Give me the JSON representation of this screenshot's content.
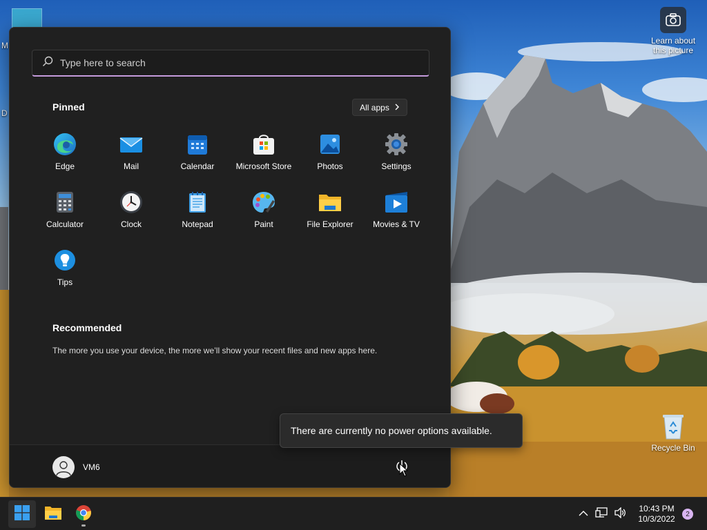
{
  "desktop": {
    "learn_label_line1": "Learn about",
    "learn_label_line2": "this picture",
    "recycle_label": "Recycle Bin",
    "left_label_1": "M",
    "left_label_2": "D"
  },
  "start_menu": {
    "search_placeholder": "Type here to search",
    "pinned_title": "Pinned",
    "all_apps_label": "All apps",
    "pinned_apps": [
      {
        "label": "Edge",
        "icon": "edge-icon"
      },
      {
        "label": "Mail",
        "icon": "mail-icon"
      },
      {
        "label": "Calendar",
        "icon": "calendar-icon"
      },
      {
        "label": "Microsoft Store",
        "icon": "store-icon"
      },
      {
        "label": "Photos",
        "icon": "photos-icon"
      },
      {
        "label": "Settings",
        "icon": "settings-icon"
      },
      {
        "label": "Calculator",
        "icon": "calculator-icon"
      },
      {
        "label": "Clock",
        "icon": "clock-icon"
      },
      {
        "label": "Notepad",
        "icon": "notepad-icon"
      },
      {
        "label": "Paint",
        "icon": "paint-icon"
      },
      {
        "label": "File Explorer",
        "icon": "file-explorer-icon"
      },
      {
        "label": "Movies & TV",
        "icon": "movies-tv-icon"
      },
      {
        "label": "Tips",
        "icon": "tips-icon"
      }
    ],
    "recommended_title": "Recommended",
    "recommended_text": "The more you use your device, the more we’ll show your recent files and new apps here.",
    "user_name": "VM6"
  },
  "tooltip": {
    "text": "There are currently no power options available."
  },
  "taskbar": {
    "time": "10:43 PM",
    "date": "10/3/2022",
    "notification_count": "2"
  },
  "colors": {
    "accent": "#c49bdc",
    "menu_bg": "#202020",
    "taskbar_bg": "#1f1f1f"
  }
}
